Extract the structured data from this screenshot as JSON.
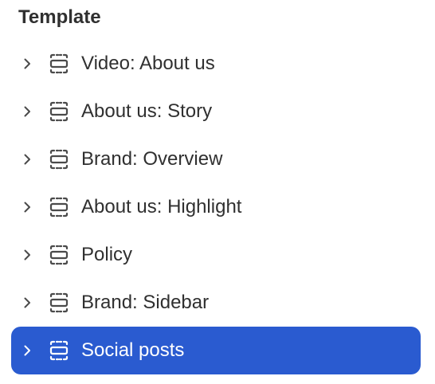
{
  "panel": {
    "heading": "Template",
    "selected_color": "#2a5bd0",
    "items": [
      {
        "label": "Video: About us",
        "chevron": "chevron-right-icon",
        "icon": "section-icon",
        "selected": false
      },
      {
        "label": "About us: Story",
        "chevron": "chevron-right-icon",
        "icon": "section-icon",
        "selected": false
      },
      {
        "label": "Brand: Overview",
        "chevron": "chevron-right-icon",
        "icon": "section-icon",
        "selected": false
      },
      {
        "label": "About us: Highlight",
        "chevron": "chevron-right-icon",
        "icon": "section-icon",
        "selected": false
      },
      {
        "label": "Policy",
        "chevron": "chevron-right-icon",
        "icon": "section-icon",
        "selected": false
      },
      {
        "label": "Brand: Sidebar",
        "chevron": "chevron-right-icon",
        "icon": "section-icon",
        "selected": false
      },
      {
        "label": "Social posts",
        "chevron": "chevron-right-icon",
        "icon": "section-icon",
        "selected": true
      }
    ]
  }
}
